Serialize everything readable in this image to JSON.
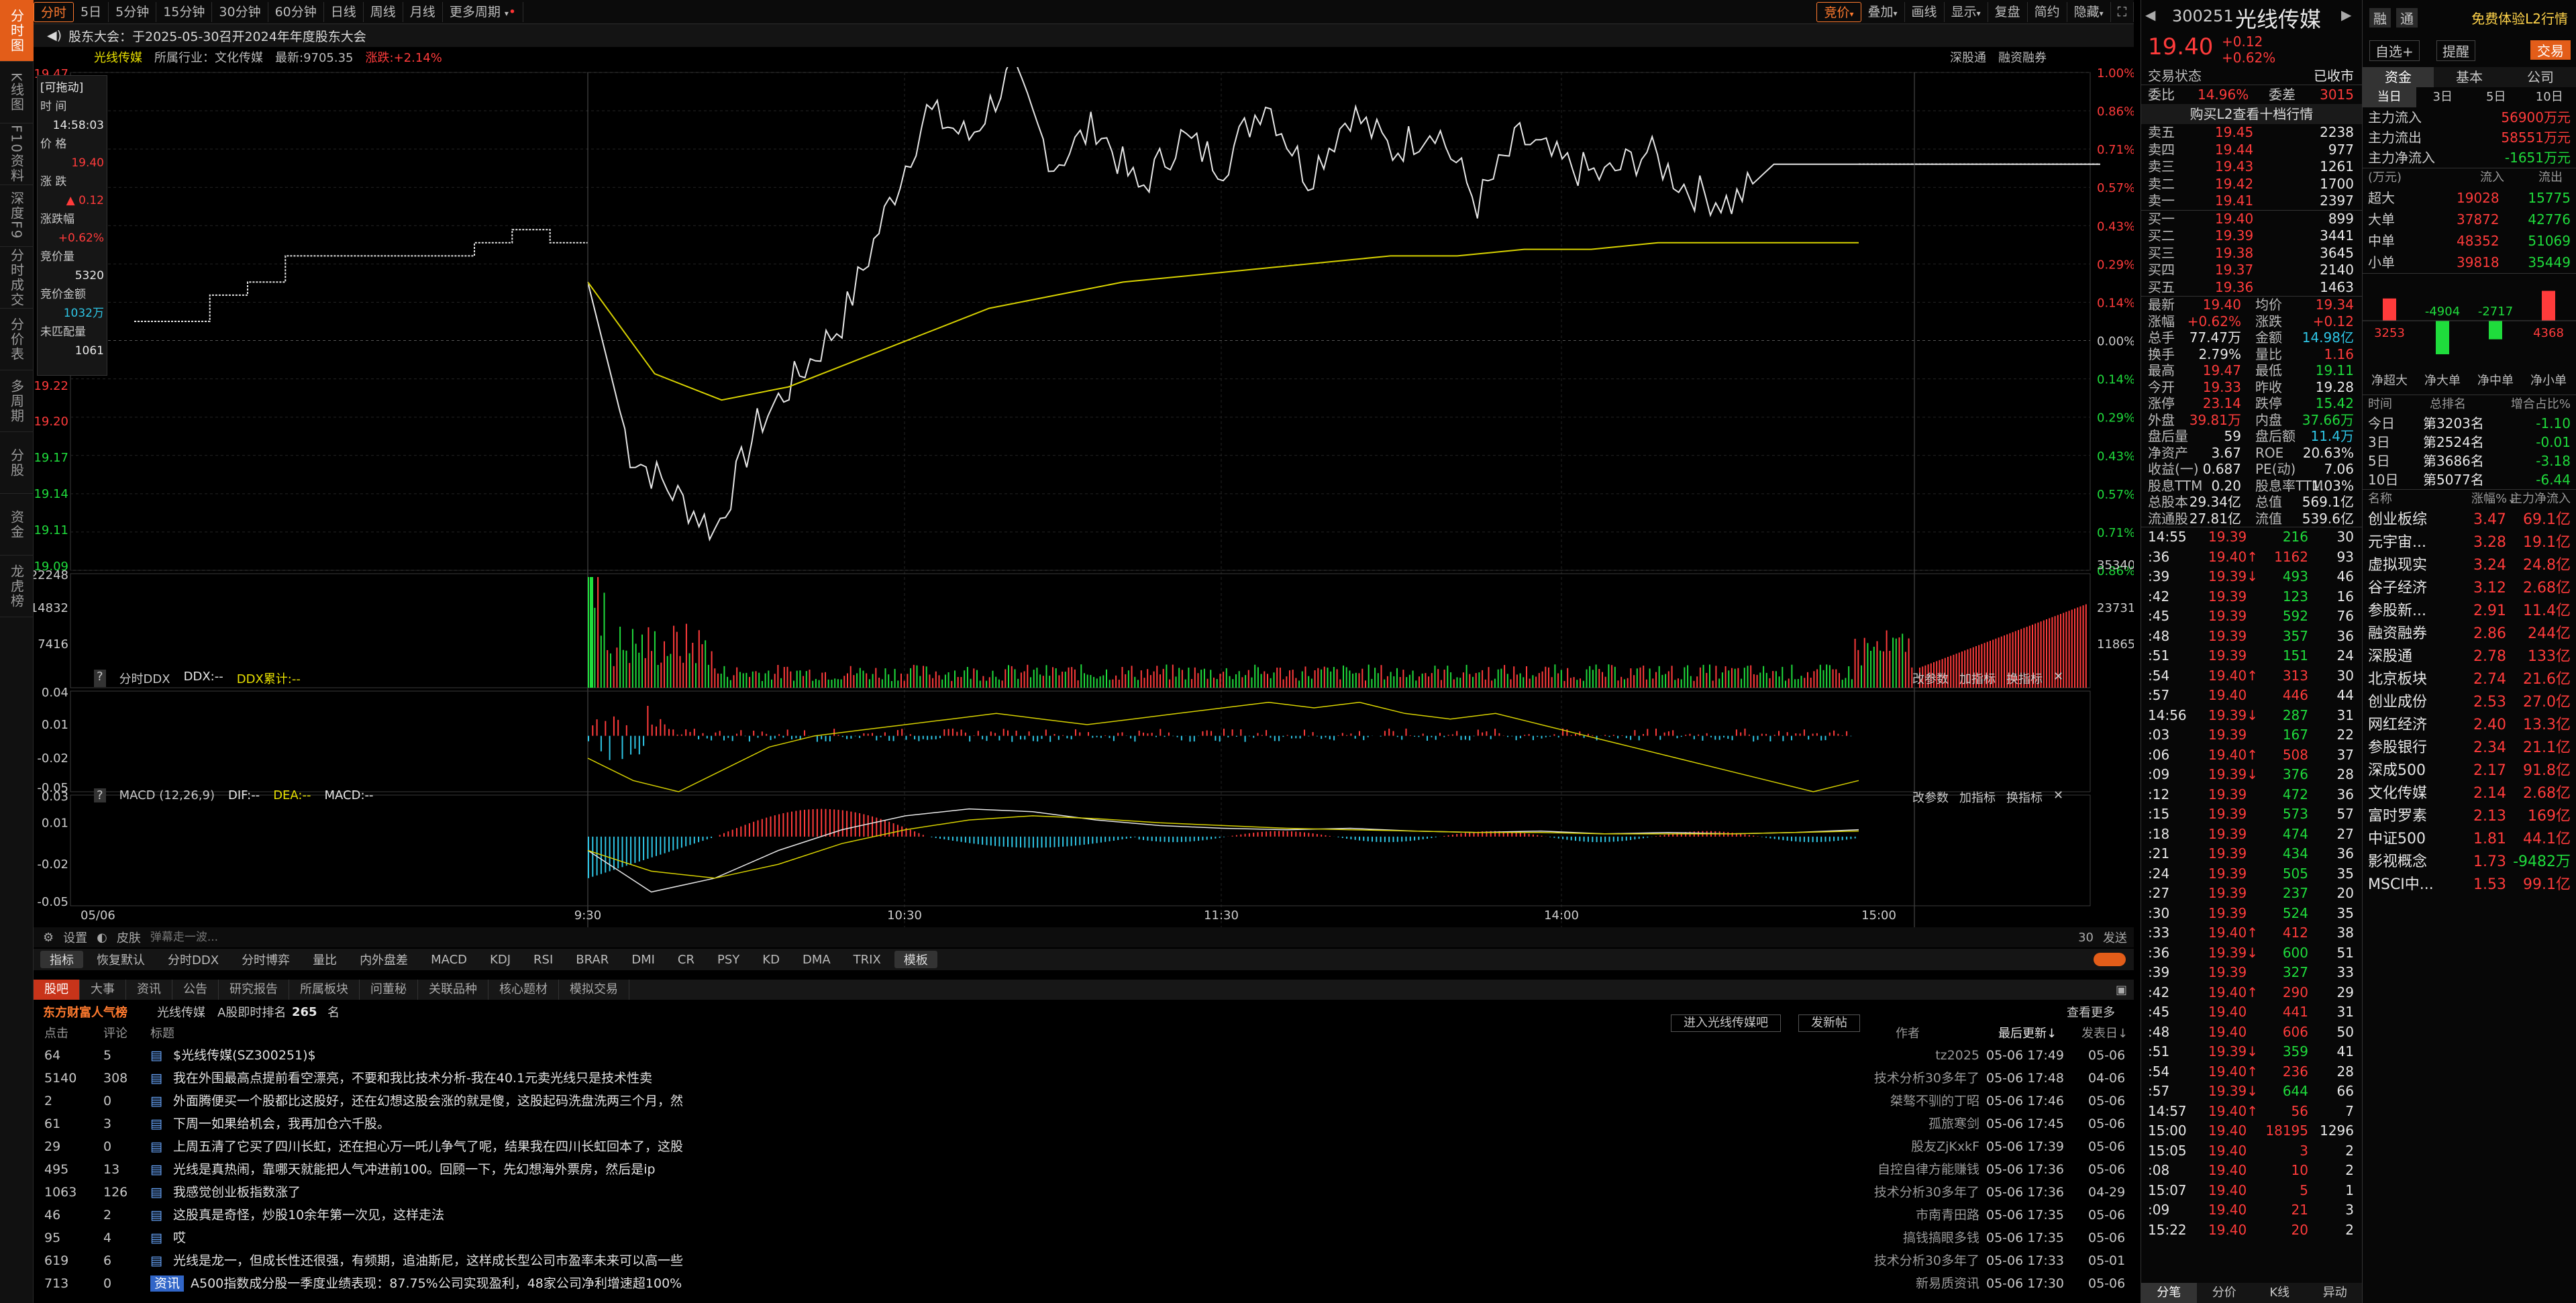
{
  "left_nav": [
    "分时图",
    "K线图",
    "F10资料",
    "深度F9",
    "分时成交",
    "分价表",
    "多周期",
    "分股",
    "资金",
    "龙虎榜"
  ],
  "top_tabs": [
    "分时",
    "5日",
    "5分钟",
    "15分钟",
    "30分钟",
    "60分钟",
    "日线",
    "周线",
    "月线",
    "更多周期"
  ],
  "top_right_tabs": [
    "竞价",
    "叠加",
    "画线",
    "显示",
    "复盘",
    "简约",
    "隐藏"
  ],
  "notice": "股东大会：于2025-05-30召开2024年年度股东大会",
  "sub_info": {
    "name": "光线传媒",
    "industry": "所属行业：文化传媒",
    "latest": "最新:9705.35",
    "change": "涨跌:+2.14%",
    "right1": "深股通",
    "right2": "融资融券"
  },
  "hover": {
    "title": "[可拖动]",
    "time_label": "时 间",
    "time": "14:58:03",
    "price_label": "价 格",
    "price": "19.40",
    "chg_label": "涨 跌",
    "chg": "▲ 0.12",
    "pct_label": "涨跌幅",
    "pct": "+0.62%",
    "bid_vol_label": "竞价量",
    "bid_vol": "5320",
    "bid_amt_label": "竞价金额",
    "bid_amt": "1032万",
    "unmatched_label": "未匹配量",
    "unmatched": "1061"
  },
  "chart_data": [
    {
      "type": "line",
      "title": "",
      "y_left_ticks": [
        "19.47",
        "19.22",
        "19.20",
        "19.17",
        "19.14",
        "19.11",
        "19.09"
      ],
      "y_right_ticks": [
        "1.00%",
        "0.86%",
        "0.71%",
        "0.57%",
        "0.43%",
        "0.29%",
        "0.14%",
        "0.00%",
        "0.14%",
        "0.29%",
        "0.43%",
        "0.57%",
        "0.71%",
        "0.86%"
      ],
      "x_ticks": [
        "05/06",
        "9:30",
        "10:30",
        "11:30",
        "14:00",
        "15:00"
      ],
      "prev_close": 19.28,
      "auction_price": [
        19.28,
        19.28,
        19.3,
        19.31,
        19.33,
        19.33,
        19.33,
        19.33,
        19.33,
        19.34,
        19.35,
        19.34
      ],
      "price": [
        19.31,
        19.18,
        19.15,
        19.12,
        19.2,
        19.24,
        19.28,
        19.36,
        19.44,
        19.42,
        19.47,
        19.4,
        19.43,
        19.38,
        19.42,
        19.4,
        19.45,
        19.39,
        19.44,
        19.41,
        19.43,
        19.37,
        19.42,
        19.4,
        19.39,
        19.41,
        19.38,
        19.37,
        19.4,
        19.4,
        19.4
      ],
      "avg_price": [
        19.31,
        19.24,
        19.22,
        19.23,
        19.25,
        19.27,
        19.29,
        19.3,
        19.31,
        19.315,
        19.32,
        19.325,
        19.33,
        19.33,
        19.335,
        19.335,
        19.34,
        19.34,
        19.34,
        19.34
      ]
    },
    {
      "type": "bar",
      "title": "",
      "y_ticks": [
        "22248",
        "14832",
        "7416"
      ],
      "y_right_ticks": [
        "35340",
        "23731",
        "11865"
      ]
    },
    {
      "type": "line",
      "title": "分时DDX",
      "legend": [
        "DDX:--",
        "DDX累计:--"
      ],
      "y_ticks": [
        "0.04",
        "0.01",
        "-0.02",
        "-0.05"
      ],
      "right_btns": [
        "改参数",
        "加指标",
        "换指标"
      ]
    },
    {
      "type": "line",
      "title": "MACD (12,26,9)",
      "legend": [
        "DIF:--",
        "DEA:--",
        "MACD:--"
      ],
      "y_ticks": [
        "0.03",
        "0.01",
        "-0.02",
        "-0.05"
      ],
      "right_btns": [
        "改参数",
        "加指标",
        "换指标"
      ]
    }
  ],
  "toolbar": {
    "settings": "设置",
    "skin": "皮肤",
    "danmu_placeholder": "弹幕走一波...",
    "count": "30",
    "send": "发送"
  },
  "indicators": [
    "指标",
    "恢复默认",
    "分时DDX",
    "分时博弈",
    "量比",
    "内外盘差",
    "MACD",
    "KDJ",
    "RSI",
    "BRAR",
    "DMI",
    "CR",
    "PSY",
    "KD",
    "DMA",
    "TRIX",
    "模板"
  ],
  "news_tabs": [
    "股吧",
    "大事",
    "资讯",
    "公告",
    "研究报告",
    "所属板块",
    "问董秘",
    "关联品种",
    "核心题材",
    "模拟交易"
  ],
  "news_head": {
    "brand": "东方财富人气榜",
    "stock": "光线传媒",
    "rank_label": "A股即时排名",
    "rank": "265",
    "rank_unit": "名",
    "enter_btn": "进入光线传媒吧",
    "post_btn": "发新帖",
    "more": "查看更多"
  },
  "news_cols": {
    "clicks": "点击",
    "comments": "评论",
    "title": "标题",
    "author": "作者",
    "updated": "最后更新↓",
    "posted": "发表日↓"
  },
  "news": [
    {
      "clicks": "64",
      "comments": "5",
      "title": "$光线传媒(SZ300251)$",
      "author": "tz2025",
      "updated": "05-06 17:49",
      "posted": "05-06"
    },
    {
      "clicks": "5140",
      "comments": "308",
      "title": "我在外围最高点提前看空漂亮，不要和我比技术分析-我在40.1元卖光线只是技术性卖",
      "author": "技术分析30多年了",
      "updated": "05-06 17:48",
      "posted": "04-06"
    },
    {
      "clicks": "2",
      "comments": "0",
      "title": "外面腾便买一个股都比这股好，还在幻想这股会涨的就是傻，这股起码洗盘洗两三个月，然",
      "author": "桀骜不驯的丁昭",
      "updated": "05-06 17:46",
      "posted": "05-06"
    },
    {
      "clicks": "61",
      "comments": "3",
      "title": "下周一如果给机会，我再加仓六千股。",
      "author": "孤旅寒剑",
      "updated": "05-06 17:45",
      "posted": "05-06"
    },
    {
      "clicks": "29",
      "comments": "0",
      "title": "上周五清了它买了四川长虹，还在担心万一吒儿争气了呢，结果我在四川长虹回本了，这股",
      "author": "股友ZjKxkF",
      "updated": "05-06 17:39",
      "posted": "05-06"
    },
    {
      "clicks": "495",
      "comments": "13",
      "title": "光线是真热闹，靠哪天就能把人气冲进前100。回顾一下，先幻想海外票房，然后是ip",
      "author": "自控自律方能赚钱",
      "updated": "05-06 17:36",
      "posted": "05-06"
    },
    {
      "clicks": "1063",
      "comments": "126",
      "title": "我感觉创业板指数涨了",
      "author": "技术分析30多年了",
      "updated": "05-06 17:36",
      "posted": "04-29"
    },
    {
      "clicks": "46",
      "comments": "2",
      "title": "这股真是奇怪，炒股10余年第一次见，这样走法",
      "author": "市南青田路",
      "updated": "05-06 17:35",
      "posted": "05-06"
    },
    {
      "clicks": "95",
      "comments": "4",
      "title": "哎",
      "author": "搞钱搞眼多钱",
      "updated": "05-06 17:35",
      "posted": "05-06"
    },
    {
      "clicks": "619",
      "comments": "6",
      "title": "光线是龙一，但成长性还很强，有频期，追油斯尼，这样成长型公司市盈率未来可以高一些",
      "author": "技术分析30多年了",
      "updated": "05-06 17:33",
      "posted": "05-01"
    },
    {
      "clicks": "713",
      "comments": "0",
      "title": "A500指数成分股一季度业绩表现：87.75%公司实现盈利，48家公司净利增速超100%",
      "author": "新易质资讯",
      "updated": "05-06 17:30",
      "posted": "05-06",
      "tag": "资讯"
    }
  ],
  "quote": {
    "code": "300251",
    "name": "光线传媒",
    "tabs": [
      "融",
      "通"
    ],
    "price": "19.40",
    "chg": "+0.12",
    "pct": "+0.62%",
    "btns": [
      "自选+",
      "提醒",
      "交易"
    ],
    "state_label": "交易状态",
    "state": "已收市",
    "weibi_label": "委比",
    "weibi": "14.96%",
    "weicha_label": "委差",
    "weicha": "3015",
    "l2_btn": "购买L2查看十档行情",
    "asks": [
      [
        "卖五",
        "19.45",
        "2238"
      ],
      [
        "卖四",
        "19.44",
        "977"
      ],
      [
        "卖三",
        "19.43",
        "1261"
      ],
      [
        "卖二",
        "19.42",
        "1700"
      ],
      [
        "卖一",
        "19.41",
        "2397"
      ]
    ],
    "bids": [
      [
        "买一",
        "19.40",
        "899"
      ],
      [
        "买二",
        "19.39",
        "3441"
      ],
      [
        "买三",
        "19.38",
        "3645"
      ],
      [
        "买四",
        "19.37",
        "2140"
      ],
      [
        "买五",
        "19.36",
        "1463"
      ]
    ],
    "stats": [
      [
        "最新",
        "19.40",
        "均价",
        "19.34"
      ],
      [
        "涨幅",
        "+0.62%",
        "涨跌",
        "+0.12"
      ],
      [
        "总手",
        "77.47万",
        "金额",
        "14.98亿"
      ],
      [
        "换手",
        "2.79%",
        "量比",
        "1.16"
      ],
      [
        "最高",
        "19.47",
        "最低",
        "19.11"
      ],
      [
        "今开",
        "19.33",
        "昨收",
        "19.28"
      ],
      [
        "涨停",
        "23.14",
        "跌停",
        "15.42"
      ],
      [
        "外盘",
        "39.81万",
        "内盘",
        "37.66万"
      ],
      [
        "盘后量",
        "59",
        "盘后额",
        "11.4万"
      ],
      [
        "净资产",
        "3.67",
        "ROE",
        "20.63%"
      ],
      [
        "收益(一)",
        "0.687",
        "PE(动)",
        "7.06"
      ],
      [
        "股息TTM",
        "0.20",
        "股息率TTM",
        "1.03%"
      ],
      [
        "总股本",
        "29.34亿",
        "总值",
        "569.1亿"
      ],
      [
        "流通股",
        "27.81亿",
        "流值",
        "539.6亿"
      ]
    ],
    "ticks": [
      [
        "14:55",
        "19.39",
        "216",
        "30",
        "g"
      ],
      [
        ":36",
        "19.40↑",
        "1162",
        "93",
        "r"
      ],
      [
        ":39",
        "19.39↓",
        "493",
        "46",
        "g"
      ],
      [
        ":42",
        "19.39",
        "123",
        "16",
        "g"
      ],
      [
        ":45",
        "19.39",
        "592",
        "76",
        "g"
      ],
      [
        ":48",
        "19.39",
        "357",
        "36",
        "g"
      ],
      [
        ":51",
        "19.39",
        "151",
        "24",
        "g"
      ],
      [
        ":54",
        "19.40↑",
        "313",
        "30",
        "r"
      ],
      [
        ":57",
        "19.40",
        "446",
        "44",
        "r"
      ],
      [
        "14:56",
        "19.39↓",
        "287",
        "31",
        "g"
      ],
      [
        ":03",
        "19.39",
        "167",
        "22",
        "g"
      ],
      [
        ":06",
        "19.40↑",
        "508",
        "37",
        "r"
      ],
      [
        ":09",
        "19.39↓",
        "376",
        "28",
        "g"
      ],
      [
        ":12",
        "19.39",
        "472",
        "36",
        "g"
      ],
      [
        ":15",
        "19.39",
        "573",
        "57",
        "g"
      ],
      [
        ":18",
        "19.39",
        "474",
        "27",
        "g"
      ],
      [
        ":21",
        "19.39",
        "434",
        "36",
        "g"
      ],
      [
        ":24",
        "19.39",
        "505",
        "35",
        "g"
      ],
      [
        ":27",
        "19.39",
        "237",
        "20",
        "g"
      ],
      [
        ":30",
        "19.39",
        "524",
        "35",
        "g"
      ],
      [
        ":33",
        "19.40↑",
        "412",
        "38",
        "r"
      ],
      [
        ":36",
        "19.39↓",
        "600",
        "51",
        "g"
      ],
      [
        ":39",
        "19.39",
        "327",
        "33",
        "g"
      ],
      [
        ":42",
        "19.40↑",
        "290",
        "29",
        "r"
      ],
      [
        ":45",
        "19.40",
        "441",
        "31",
        "r"
      ],
      [
        ":48",
        "19.40",
        "606",
        "50",
        "r"
      ],
      [
        ":51",
        "19.39↓",
        "359",
        "41",
        "g"
      ],
      [
        ":54",
        "19.40↑",
        "236",
        "28",
        "r"
      ],
      [
        ":57",
        "19.39↓",
        "644",
        "66",
        "g"
      ],
      [
        "14:57",
        "19.40↑",
        "56",
        "7",
        "r"
      ],
      [
        "15:00",
        "19.40",
        "18195",
        "1296",
        "r"
      ],
      [
        "15:05",
        "19.40",
        "3",
        "2",
        "r"
      ],
      [
        ":08",
        "19.40",
        "10",
        "2",
        "r"
      ],
      [
        "15:07",
        "19.40",
        "5",
        "1",
        "r"
      ],
      [
        ":09",
        "19.40",
        "21",
        "3",
        "r"
      ],
      [
        "15:22",
        "19.40",
        "20",
        "2",
        "r"
      ]
    ],
    "bottom_tabs": [
      "分笔",
      "分价",
      "K线",
      "异动"
    ]
  },
  "side": {
    "top_link": "免费体验L2行情",
    "tabs": [
      "资金",
      "基本",
      "公司"
    ],
    "sub_tabs": [
      "当日",
      "3日",
      "5日",
      "10日"
    ],
    "flow": [
      [
        "主力流入",
        "56900万元"
      ],
      [
        "主力流出",
        "58551万元"
      ],
      [
        "主力净流入",
        "-1651万元"
      ]
    ],
    "col_heads": [
      "(万元)",
      "流入",
      "流出"
    ],
    "orders": [
      [
        "超大",
        "19028",
        "15775"
      ],
      [
        "大单",
        "37872",
        "42776"
      ],
      [
        "中单",
        "48352",
        "51069"
      ],
      [
        "小单",
        "39818",
        "35449"
      ]
    ],
    "net_bars": {
      "labels": [
        "净超大",
        "净大单",
        "净中单",
        "净小单"
      ],
      "values": [
        3253,
        -4904,
        -2717,
        4368
      ]
    },
    "hist_heads": [
      "时间",
      "总排名",
      "增合占比%"
    ],
    "hist": [
      [
        "今日",
        "第3203名",
        "-1.10"
      ],
      [
        "3日",
        "第2524名",
        "-0.01"
      ],
      [
        "5日",
        "第3686名",
        "-3.18"
      ],
      [
        "10日",
        "第5077名",
        "-6.44"
      ]
    ],
    "sector_heads": [
      "名称",
      "涨幅%↓",
      "主力净流入"
    ],
    "sectors": [
      [
        "创业板综",
        "3.47",
        "69.1亿"
      ],
      [
        "元宇宙...",
        "3.28",
        "19.1亿"
      ],
      [
        "虚拟现实",
        "3.24",
        "24.8亿"
      ],
      [
        "谷子经济",
        "3.12",
        "2.68亿"
      ],
      [
        "参股新...",
        "2.91",
        "11.4亿"
      ],
      [
        "融资融券",
        "2.86",
        "244亿"
      ],
      [
        "深股通",
        "2.78",
        "133亿"
      ],
      [
        "北京板块",
        "2.74",
        "21.6亿"
      ],
      [
        "创业成份",
        "2.53",
        "27.0亿"
      ],
      [
        "网红经济",
        "2.40",
        "13.3亿"
      ],
      [
        "参股银行",
        "2.34",
        "21.1亿"
      ],
      [
        "深成500",
        "2.17",
        "91.8亿"
      ],
      [
        "文化传媒",
        "2.14",
        "2.68亿"
      ],
      [
        "富时罗素",
        "2.13",
        "169亿"
      ],
      [
        "中证500",
        "1.81",
        "44.1亿"
      ],
      [
        "影视概念",
        "1.73",
        "-9482万"
      ],
      [
        "MSCI中...",
        "1.53",
        "99.1亿"
      ]
    ]
  }
}
